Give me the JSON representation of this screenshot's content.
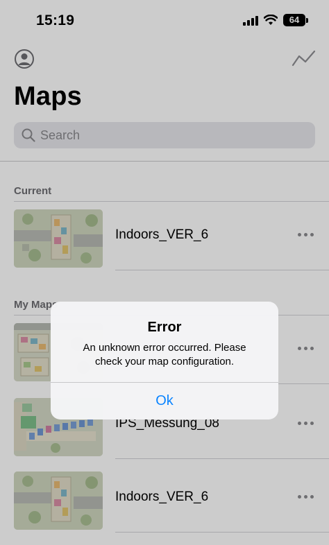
{
  "status_bar": {
    "time": "15:19",
    "battery": "64"
  },
  "header": {
    "title": "Maps",
    "profile_icon": "person-circle-icon",
    "route_icon": "route-line-icon"
  },
  "search": {
    "placeholder": "Search"
  },
  "sections": {
    "current": {
      "label": "Current",
      "items": [
        {
          "name": "Indoors_VER_6"
        }
      ]
    },
    "my_maps": {
      "label": "My Maps",
      "items": [
        {
          "name": ""
        },
        {
          "name": "IPS_Messung_08"
        },
        {
          "name": "Indoors_VER_6"
        }
      ]
    }
  },
  "alert": {
    "title": "Error",
    "message": "An unknown error occurred. Please check your map configuration.",
    "button": "Ok"
  },
  "colors": {
    "accent": "#0a84ff",
    "background": "#ffffff",
    "search_fill": "#e6e6eb"
  }
}
